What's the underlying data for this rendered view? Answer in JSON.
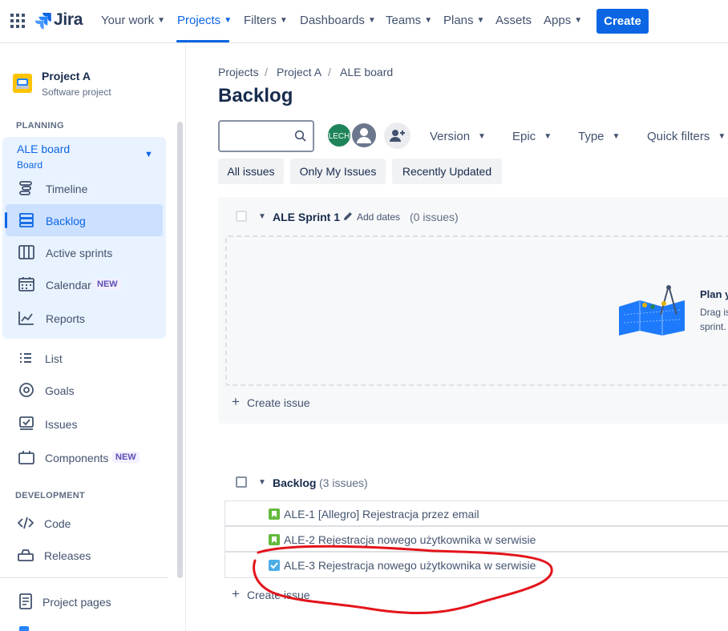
{
  "topnav": {
    "logo": "Jira",
    "items": [
      "Your work",
      "Projects",
      "Filters",
      "Dashboards",
      "Teams",
      "Plans",
      "Assets",
      "Apps"
    ],
    "active": "Projects",
    "create_label": "Create",
    "accent": "#0c66e4"
  },
  "sidebar": {
    "project_name": "Project A",
    "project_type": "Software project",
    "planning_heading": "PLANNING",
    "board_name": "ALE board",
    "board_sub": "Board",
    "planning_items": [
      "Timeline",
      "Backlog",
      "Active sprints",
      "Calendar",
      "Reports"
    ],
    "selected": "Backlog",
    "other_items": [
      "List",
      "Goals",
      "Issues",
      "Components"
    ],
    "new_badge": "NEW",
    "development_heading": "DEVELOPMENT",
    "dev_items": [
      "Code",
      "Releases"
    ],
    "bottom_items": [
      "Project pages"
    ]
  },
  "breadcrumb": [
    "Projects",
    "Project A",
    "ALE board"
  ],
  "page_title": "Backlog",
  "toolbar": {
    "search_placeholder": "",
    "avatar_initials": "LECH",
    "dropdowns": [
      "Version",
      "Epic",
      "Type",
      "Quick filters"
    ],
    "chips": [
      "All issues",
      "Only My Issues",
      "Recently Updated"
    ]
  },
  "sprint": {
    "name": "ALE Sprint 1",
    "add_dates": "Add dates",
    "count": "(0 issues)",
    "empty_title": "Plan y",
    "empty_desc_1": "Drag is",
    "empty_desc_2": "sprint.",
    "create_issue": "Create issue"
  },
  "backlog": {
    "name": "Backlog",
    "count": "(3 issues)",
    "issues": [
      {
        "key": "ALE-1",
        "summary": "[Allegro] Rejestracja przez email",
        "type": "story"
      },
      {
        "key": "ALE-2",
        "summary": "Rejestracja nowego użytkownika w serwisie",
        "type": "story"
      },
      {
        "key": "ALE-3",
        "summary": "Rejestracja nowego użytkownika w serwisie",
        "type": "task"
      }
    ],
    "create_issue": "Create issue"
  },
  "annotation_color": "#e3141b"
}
